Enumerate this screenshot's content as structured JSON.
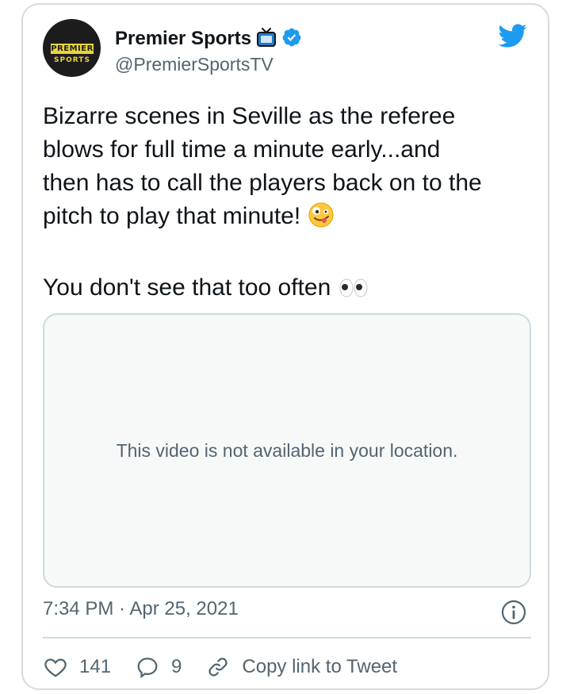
{
  "tweet": {
    "author": {
      "display_name": "Premier Sports",
      "handle": "@PremierSportsTV",
      "avatar_text_top": "PREMIER",
      "avatar_text_bottom": "SPORTS",
      "badges": [
        "tv-icon",
        "verified-badge-icon"
      ]
    },
    "text": {
      "line_1": "Bizarre scenes in Seville as the referee",
      "line_2": "blows for full time a minute early...and",
      "line_3": "then has to call the players back on to the",
      "line_4": "pitch to play that minute! ",
      "line_5": "You don't see that too often "
    },
    "emojis": [
      "zany-face-emoji",
      "eyes-emoji"
    ],
    "media": {
      "message": "This video is not available in your location."
    },
    "timestamp": "7:34 PM · Apr 25, 2021",
    "actions": {
      "likes": "141",
      "replies": "9",
      "copy_link": "Copy link to Tweet"
    }
  },
  "colors": {
    "accent": "#1d9bf0",
    "secondary_text": "#536471",
    "border": "#cfd9de",
    "brand_yellow": "#e7d43b"
  }
}
